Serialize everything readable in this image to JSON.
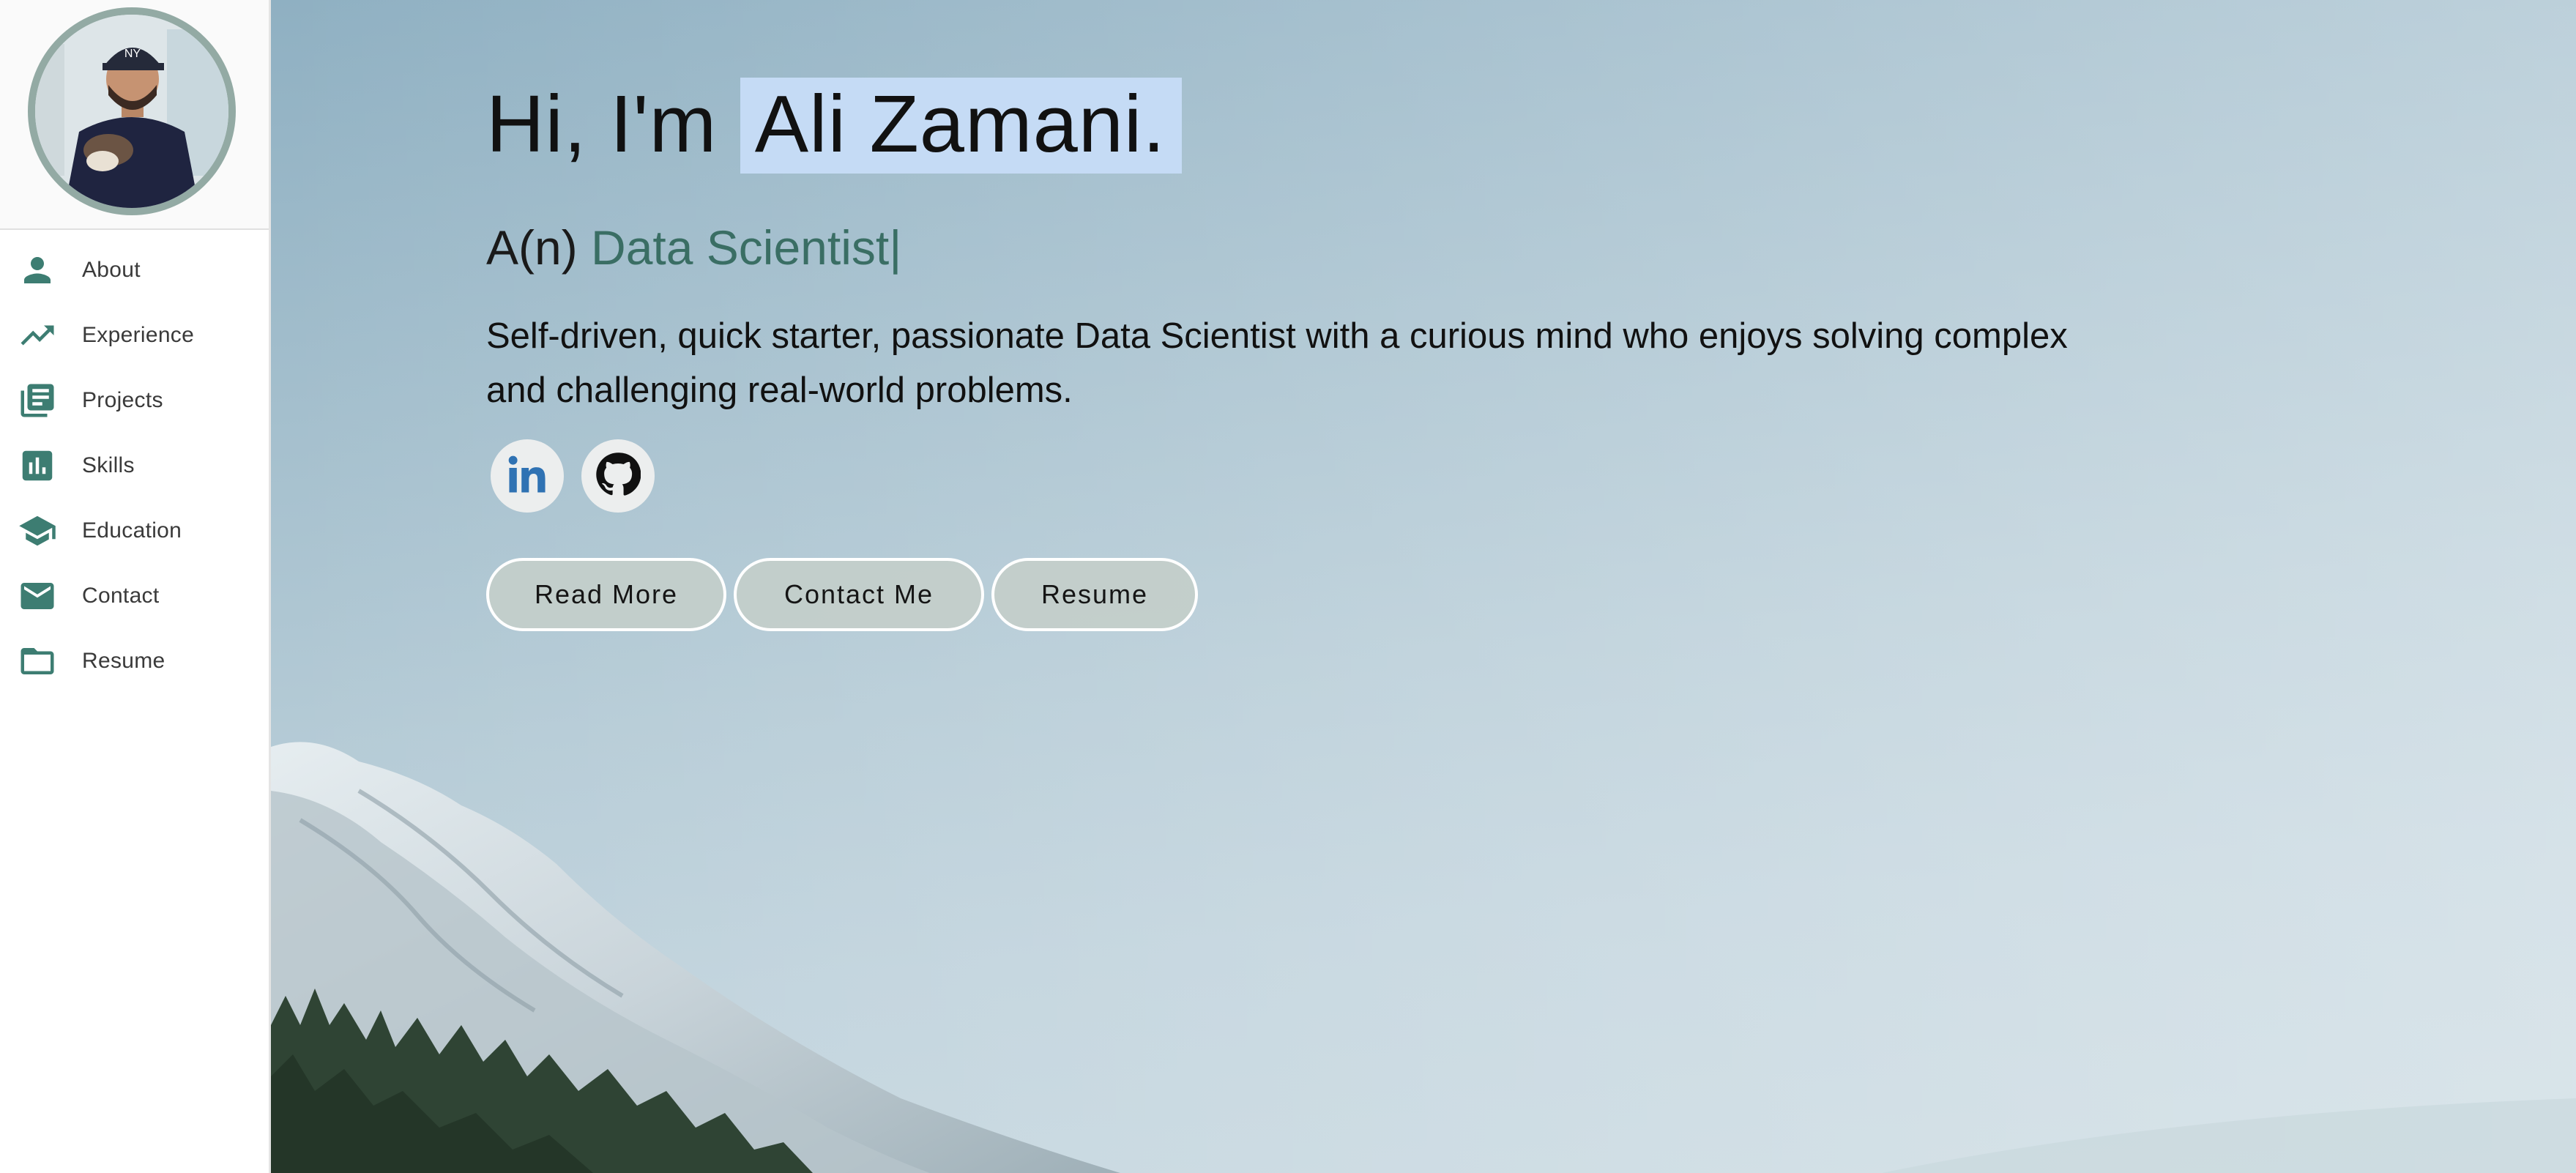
{
  "sidebar": {
    "avatar_alt": "Profile photo",
    "items": [
      {
        "label": "About",
        "icon": "person-icon"
      },
      {
        "label": "Experience",
        "icon": "trending-up-icon"
      },
      {
        "label": "Projects",
        "icon": "library-books-icon"
      },
      {
        "label": "Skills",
        "icon": "bar-chart-icon"
      },
      {
        "label": "Education",
        "icon": "graduation-cap-icon"
      },
      {
        "label": "Contact",
        "icon": "mail-icon"
      },
      {
        "label": "Resume",
        "icon": "folder-icon"
      }
    ]
  },
  "hero": {
    "greeting_prefix": "Hi, I'm",
    "name": "Ali Zamani.",
    "role_prefix": "A(n)",
    "role": "Data Scientist",
    "cursor": "|",
    "bio": "Self-driven, quick starter, passionate Data Scientist with a curious mind who enjoys solving complex and challenging real-world problems.",
    "socials": [
      {
        "name": "LinkedIn",
        "icon": "linkedin-icon"
      },
      {
        "name": "GitHub",
        "icon": "github-icon"
      }
    ],
    "buttons": {
      "read_more": "Read More",
      "contact_me": "Contact Me",
      "resume": "Resume"
    }
  },
  "colors": {
    "accent": "#3d7d72",
    "name_highlight": "#c5dbf5",
    "button_bg": "#c3ceca",
    "sky": "#a4bfcd"
  }
}
